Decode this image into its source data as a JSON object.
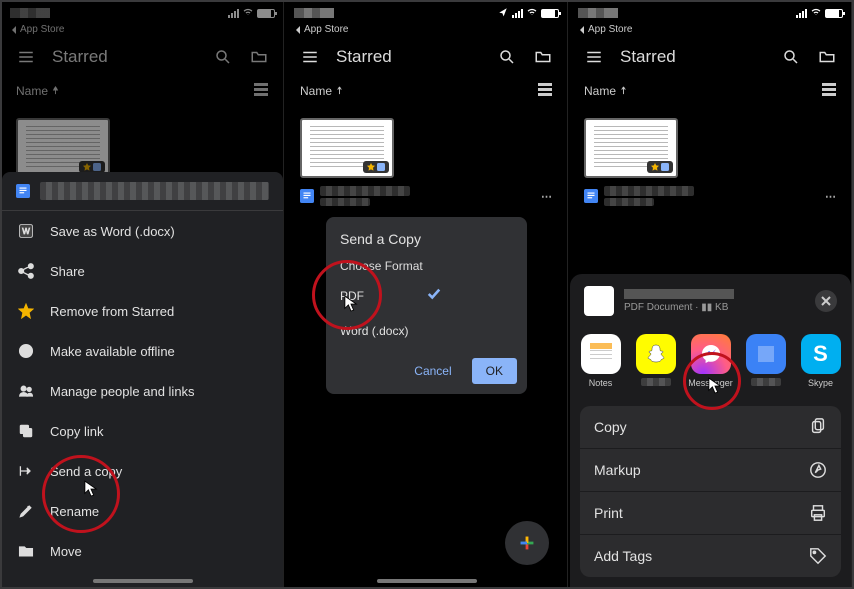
{
  "common": {
    "back": "App Store",
    "app_title": "Starred",
    "sort_label": "Name"
  },
  "frame1": {
    "sheet": {
      "items": [
        {
          "id": "save-word",
          "label": "Save as Word (.docx)"
        },
        {
          "id": "share",
          "label": "Share"
        },
        {
          "id": "unstar",
          "label": "Remove from Starred"
        },
        {
          "id": "offline",
          "label": "Make available offline"
        },
        {
          "id": "people",
          "label": "Manage people and links"
        },
        {
          "id": "copylink",
          "label": "Copy link"
        },
        {
          "id": "sendcopy",
          "label": "Send a copy"
        },
        {
          "id": "rename",
          "label": "Rename"
        },
        {
          "id": "move",
          "label": "Move"
        }
      ]
    }
  },
  "frame2": {
    "dialog": {
      "title": "Send a Copy",
      "choose": "Choose Format",
      "opt_pdf": "PDF",
      "opt_word": "Word (.docx)",
      "cancel": "Cancel",
      "ok": "OK"
    }
  },
  "frame3": {
    "share": {
      "doc_meta": "PDF Document · ▮▮ KB",
      "apps": {
        "notes": "Notes",
        "messenger": "Messenger",
        "skype": "Skype"
      },
      "actions": {
        "copy": "Copy",
        "markup": "Markup",
        "print": "Print",
        "tags": "Add Tags"
      }
    }
  }
}
